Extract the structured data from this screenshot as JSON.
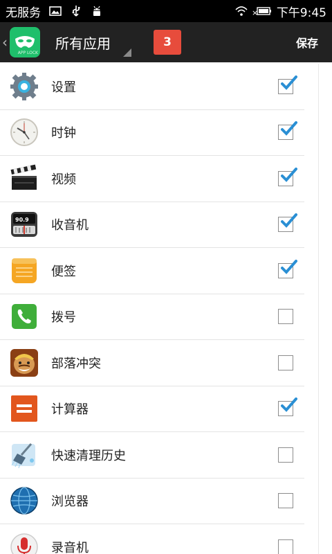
{
  "status_bar": {
    "carrier": "无服务",
    "time": "下午9:45",
    "icons": [
      "image-icon",
      "usb-icon",
      "android-icon",
      "wifi-icon",
      "battery-icon"
    ]
  },
  "action_bar": {
    "spinner_label": "所有应用",
    "count": "3",
    "save_label": "保存",
    "logo_text": "APP LOCK"
  },
  "apps": [
    {
      "name": "设置",
      "icon": "gear-icon",
      "checked": true
    },
    {
      "name": "时钟",
      "icon": "clock-icon",
      "checked": true
    },
    {
      "name": "视频",
      "icon": "clapperboard-icon",
      "checked": true
    },
    {
      "name": "收音机",
      "icon": "radio-icon",
      "checked": true
    },
    {
      "name": "便签",
      "icon": "notes-icon",
      "checked": true
    },
    {
      "name": "拨号",
      "icon": "phone-icon",
      "checked": false
    },
    {
      "name": "部落冲突",
      "icon": "game-icon",
      "checked": false
    },
    {
      "name": "计算器",
      "icon": "calculator-icon",
      "checked": true
    },
    {
      "name": "快速清理历史",
      "icon": "broom-icon",
      "checked": false
    },
    {
      "name": "浏览器",
      "icon": "globe-icon",
      "checked": false
    },
    {
      "name": "录音机",
      "icon": "microphone-icon",
      "checked": false
    }
  ],
  "colors": {
    "accent_check": "#2a8fd4",
    "badge": "#e74c3c",
    "logo_green": "#1fbf6b",
    "action_bar": "#222222"
  }
}
